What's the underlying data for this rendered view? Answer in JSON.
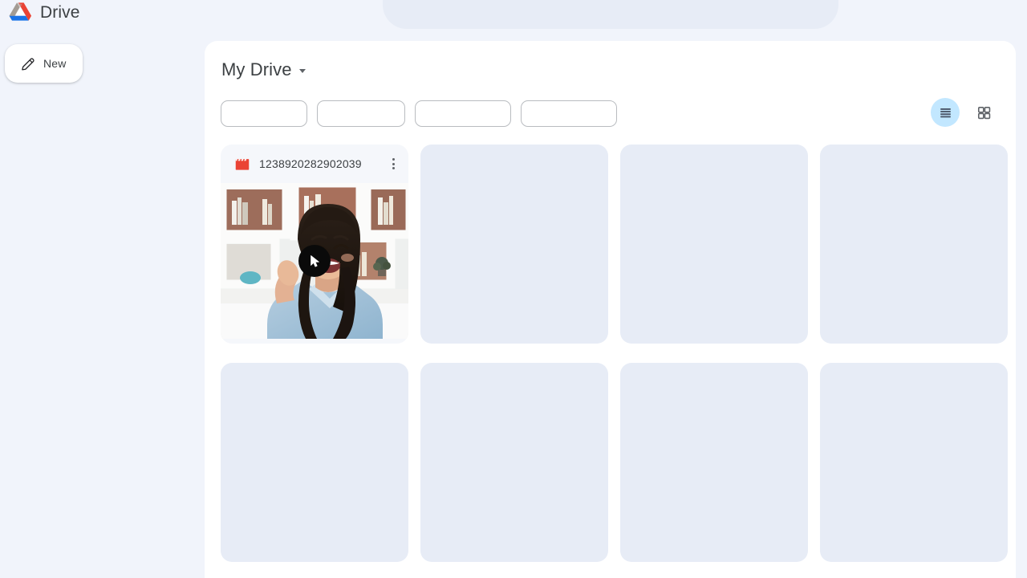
{
  "app": {
    "brand_name": "Drive",
    "logo_icon": "google-drive-logo"
  },
  "search": {
    "placeholder": "",
    "value": ""
  },
  "sidebar": {
    "new_button": {
      "label": "New",
      "icon": "pencil-icon"
    }
  },
  "main": {
    "title": "My Drive",
    "title_caret_icon": "chevron-down-icon",
    "filters": [
      {
        "label": "",
        "name": "filter-chip-type"
      },
      {
        "label": "",
        "name": "filter-chip-people"
      },
      {
        "label": "",
        "name": "filter-chip-modified"
      },
      {
        "label": "",
        "name": "filter-chip-source"
      }
    ],
    "view_toggles": {
      "list": {
        "icon": "list-view-icon",
        "active": true
      },
      "grid": {
        "icon": "grid-view-icon",
        "active": false
      }
    },
    "active_toggle_color": "#c2e7ff"
  },
  "files": [
    {
      "name": "1238920282902039",
      "type_icon": "video-clapperboard-icon",
      "type_icon_color": "#ea4335",
      "menu_icon": "more-vertical-icon",
      "thumbnail": "video-thumbnail-woman-bookshelf",
      "overlay_icon": "cursor-badge-icon",
      "is_placeholder": false
    },
    {
      "name": "",
      "is_placeholder": true
    },
    {
      "name": "",
      "is_placeholder": true
    },
    {
      "name": "",
      "is_placeholder": true
    },
    {
      "name": "",
      "is_placeholder": true
    },
    {
      "name": "",
      "is_placeholder": true
    },
    {
      "name": "",
      "is_placeholder": true
    },
    {
      "name": "",
      "is_placeholder": true
    }
  ],
  "colors": {
    "page_background": "#f1f4fb",
    "panel_background": "#ffffff",
    "placeholder_card": "#e7ecf6",
    "search_background": "#e7ecf6",
    "text_primary": "#3c4043"
  }
}
